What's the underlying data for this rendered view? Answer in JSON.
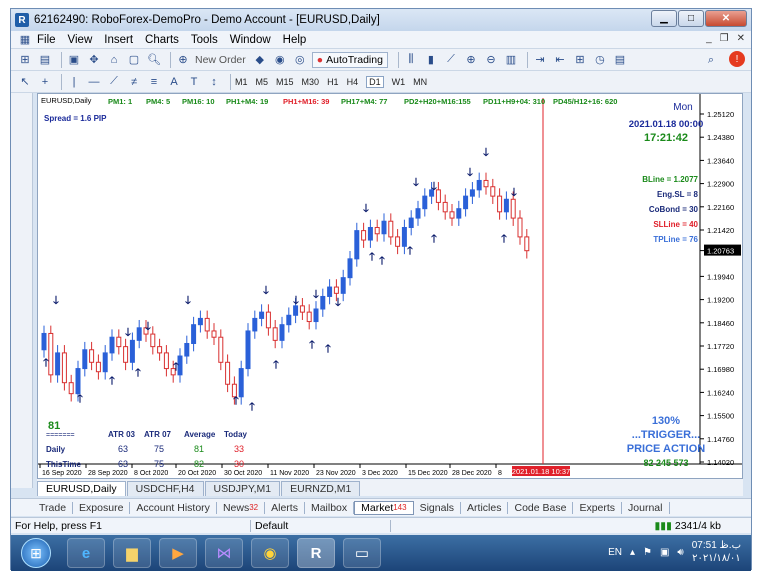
{
  "window": {
    "title": "62162490: RoboForex-DemoPro - Demo Account - [EURUSD,Daily]",
    "app_icon": "R"
  },
  "menu": [
    "File",
    "View",
    "Insert",
    "Charts",
    "Tools",
    "Window",
    "Help"
  ],
  "toolbar": {
    "new_order": "New Order",
    "autotrading": "AutoTrading"
  },
  "timeframes": [
    "M1",
    "M5",
    "M15",
    "M30",
    "H1",
    "H4",
    "D1",
    "W1",
    "MN"
  ],
  "active_timeframe": "D1",
  "chart": {
    "symbol_label": "EURUSD,Daily",
    "spread": "Spread = 1.6  PIP",
    "day": "Mon",
    "date": "2021.01.18 00:00",
    "time": "17:21:42",
    "top_labels": [
      {
        "text": "PM1: 1",
        "color": "#1a8a1a"
      },
      {
        "text": "PM4: 5",
        "color": "#1a8a1a"
      },
      {
        "text": "PM16: 10",
        "color": "#1a8a1a"
      },
      {
        "text": "PH1+M4: 19",
        "color": "#1a8a1a"
      },
      {
        "text": "PH1+M16: 39",
        "color": "#e0202a"
      },
      {
        "text": "PH17+M4: 77",
        "color": "#1a8a1a"
      },
      {
        "text": "PD2+H20+M16:155",
        "color": "#1a8a1a"
      },
      {
        "text": "PD11+H9+04: 310",
        "color": "#1a8a1a"
      },
      {
        "text": "PD45/H12+16: 620",
        "color": "#1a8a1a"
      }
    ],
    "right_labels": [
      {
        "text": "BLine  = 1.2077",
        "color": "#1a8a1a"
      },
      {
        "text": "Eng.SL = 8",
        "color": "#1a2a7a"
      },
      {
        "text": "CoBond = 30",
        "color": "#1a2a7a"
      },
      {
        "text": "SLLine = 40",
        "color": "#e0202a"
      },
      {
        "text": "TPLine = 76",
        "color": "#3a6fd8"
      }
    ],
    "price_ticks": [
      "1.25120",
      "1.24380",
      "1.23640",
      "1.22900",
      "1.22160",
      "1.21420",
      "1.20763",
      "1.19940",
      "1.19200",
      "1.18460",
      "1.17720",
      "1.16980",
      "1.16240",
      "1.15500",
      "1.14760",
      "1.14020"
    ],
    "current_price": "1.20763",
    "date_ticks": [
      "16 Sep 2020",
      "28 Sep 2020",
      "8 Oct 2020",
      "20 Oct 2020",
      "30 Oct 2020",
      "11 Nov 2020",
      "23 Nov 2020",
      "3 Dec 2020",
      "15 Dec 2020",
      "28 Dec 2020",
      "8"
    ],
    "cursor_date": "2021.01.18 10:37",
    "atr": {
      "count": "81",
      "separator": "=======",
      "headers": [
        "ATR 03",
        "ATR 07",
        "Average",
        "Today"
      ],
      "rows": [
        {
          "label": "Daily",
          "values": [
            "63",
            "75",
            "81",
            "33"
          ]
        },
        {
          "label": "ThisTime",
          "values": [
            "63",
            "75",
            "82",
            "30"
          ]
        }
      ]
    },
    "trigger": {
      "pct": "130%",
      "line1": "...TRIGGER...",
      "line2": "PRICE ACTION",
      "nums": "82  245  573"
    }
  },
  "chart_tabs": [
    "EURUSD,Daily",
    "USDCHF,H4",
    "USDJPY,M1",
    "EURNZD,M1"
  ],
  "terminal_tabs": [
    {
      "label": "Trade",
      "badge": ""
    },
    {
      "label": "Exposure",
      "badge": ""
    },
    {
      "label": "Account History",
      "badge": ""
    },
    {
      "label": "News",
      "badge": "32"
    },
    {
      "label": "Alerts",
      "badge": ""
    },
    {
      "label": "Mailbox",
      "badge": ""
    },
    {
      "label": "Market",
      "badge": "143"
    },
    {
      "label": "Signals",
      "badge": ""
    },
    {
      "label": "Articles",
      "badge": ""
    },
    {
      "label": "Code Base",
      "badge": ""
    },
    {
      "label": "Experts",
      "badge": ""
    },
    {
      "label": "Journal",
      "badge": ""
    }
  ],
  "terminal_active": "Market",
  "status": {
    "help": "For Help, press F1",
    "profile": "Default",
    "traffic": "2341/4 kb"
  },
  "taskbar": {
    "lang": "EN",
    "time": "07:51 ب.ظ",
    "date": "۲۰۲۱/۱۸/۰۱"
  }
}
